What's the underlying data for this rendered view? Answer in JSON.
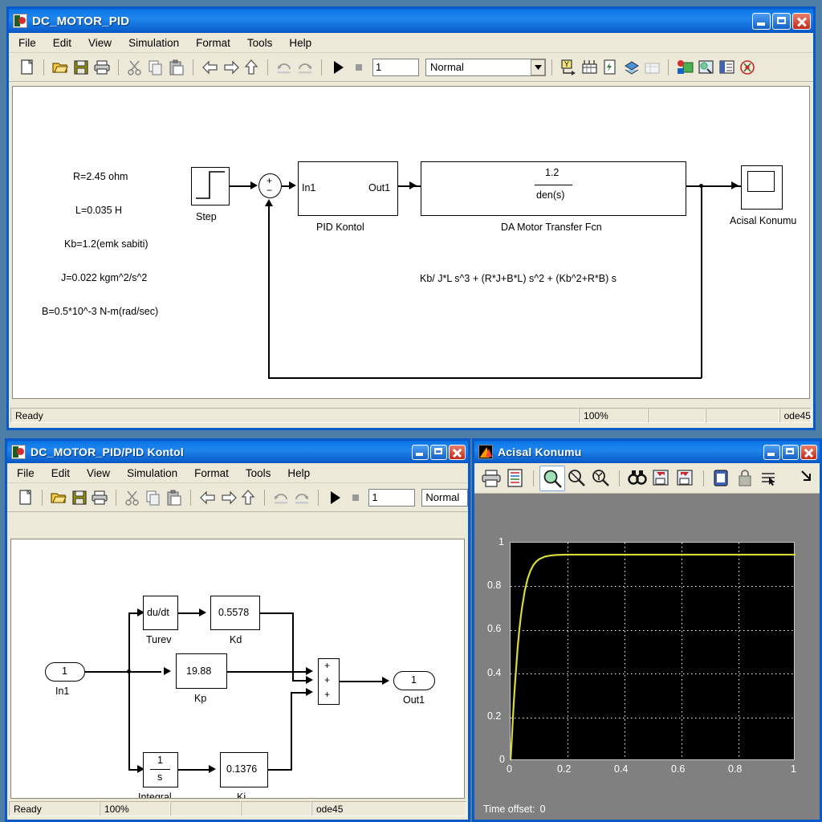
{
  "windows": {
    "model": {
      "title": "DC_MOTOR_PID",
      "menu": [
        "File",
        "Edit",
        "View",
        "Simulation",
        "Format",
        "Tools",
        "Help"
      ],
      "toolbar": {
        "stop_time": "1",
        "sim_mode": "Normal",
        "icons": [
          "new-icon",
          "open-icon",
          "save-icon",
          "print-icon",
          "cut-icon",
          "copy-icon",
          "paste-icon",
          "back-icon",
          "forward-icon",
          "up-icon",
          "undo-icon",
          "redo-icon",
          "start-icon",
          "stop-icon",
          "scope-manager-icon",
          "debug-icon",
          "update-diagram-icon",
          "build-icon",
          "model-explorer-icon",
          "library-browser-icon",
          "toggle-model-browser-icon",
          "properties-icon",
          "help-icon"
        ]
      },
      "status": {
        "ready": "Ready",
        "zoom": "100%",
        "field3": "",
        "field4": "",
        "solver": "ode45"
      },
      "diagram": {
        "parameters": [
          "R=2.45 ohm",
          "L=0.035 H",
          "Kb=1.2(emk sabiti)",
          "J=0.022 kgm^2/s^2",
          "B=0.5*10^-3 N-m(rad/sec)"
        ],
        "step_label": "Step",
        "sum_signs": [
          "+",
          "−"
        ],
        "subsystem": {
          "in_port": "In1",
          "out_port": "Out1",
          "label": "PID Kontol"
        },
        "transfer_fcn": {
          "numerator": "1.2",
          "denominator": "den(s)",
          "label": "DA Motor Transfer Fcn"
        },
        "denominator_expression": "Kb/ J*L s^3 + (R*J+B*L) s^2 + (Kb^2+R*B) s",
        "scope_label": "Acisal Konumu"
      }
    },
    "pid": {
      "title": "DC_MOTOR_PID/PID Kontol",
      "menu": [
        "File",
        "Edit",
        "View",
        "Simulation",
        "Format",
        "Tools",
        "Help"
      ],
      "toolbar": {
        "stop_time": "1",
        "sim_mode": "Normal"
      },
      "status": {
        "ready": "Ready",
        "zoom": "100%",
        "field3": "",
        "field4": "",
        "solver": "ode45"
      },
      "diagram": {
        "in_port": {
          "number": "1",
          "label": "In1"
        },
        "out_port": {
          "number": "1",
          "label": "Out1"
        },
        "derivative": {
          "text": "du/dt",
          "label": "Turev"
        },
        "kd": {
          "value": "0.5578",
          "label": "Kd"
        },
        "kp": {
          "value": "19.88",
          "label": "Kp"
        },
        "integral": {
          "numerator": "1",
          "denominator": "s",
          "label": "Integral"
        },
        "ki": {
          "value": "0.1376",
          "label": "Ki"
        },
        "sum_signs": [
          "+",
          "+",
          "+"
        ]
      }
    },
    "scope": {
      "title": "Acisal Konumu",
      "toolbar_icons": [
        "print-icon",
        "parameters-icon",
        "zoom-box-icon",
        "zoom-x-icon",
        "zoom-y-icon",
        "autoscale-icon",
        "save-axes-icon",
        "restore-axes-icon",
        "floating-scope-icon",
        "lock-axes-icon",
        "signal-selection-icon",
        "overflow-chevron-icon"
      ],
      "status": {
        "time_offset_label": "Time offset:",
        "time_offset_value": "0"
      }
    }
  },
  "chart_data": {
    "type": "line",
    "title": "Acisal Konumu",
    "xlabel": "",
    "ylabel": "",
    "xlim": [
      0,
      1
    ],
    "ylim": [
      0,
      1
    ],
    "xticks": [
      "0",
      "0.2",
      "0.4",
      "0.6",
      "0.8",
      "1"
    ],
    "yticks": [
      "0",
      "0.2",
      "0.4",
      "0.6",
      "0.8",
      "1"
    ],
    "grid": true,
    "legend": "none",
    "series": [
      {
        "name": "Acisal Konumu",
        "color": "#d9d93a",
        "x": [
          0,
          0.004,
          0.008,
          0.012,
          0.016,
          0.02,
          0.025,
          0.03,
          0.035,
          0.04,
          0.05,
          0.06,
          0.07,
          0.08,
          0.09,
          0.1,
          0.12,
          0.14,
          0.16,
          0.18,
          0.2,
          0.3,
          0.4,
          0.5,
          0.6,
          0.7,
          0.8,
          0.9,
          1.0
        ],
        "y": [
          0,
          0.09,
          0.19,
          0.28,
          0.36,
          0.43,
          0.52,
          0.59,
          0.65,
          0.7,
          0.78,
          0.835,
          0.872,
          0.897,
          0.913,
          0.924,
          0.936,
          0.941,
          0.9435,
          0.9445,
          0.945,
          0.945,
          0.945,
          0.945,
          0.945,
          0.945,
          0.945,
          0.945,
          0.945
        ]
      }
    ]
  }
}
